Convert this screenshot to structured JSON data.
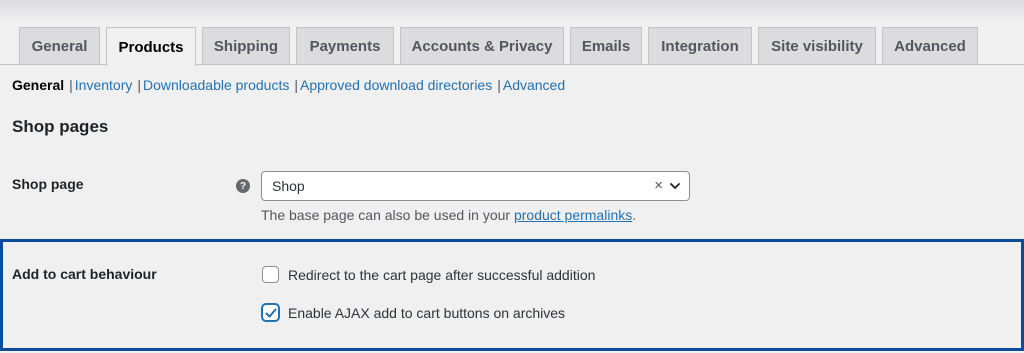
{
  "tabs": [
    {
      "label": "General",
      "active": false
    },
    {
      "label": "Products",
      "active": true
    },
    {
      "label": "Shipping",
      "active": false
    },
    {
      "label": "Payments",
      "active": false
    },
    {
      "label": "Accounts & Privacy",
      "active": false
    },
    {
      "label": "Emails",
      "active": false
    },
    {
      "label": "Integration",
      "active": false
    },
    {
      "label": "Site visibility",
      "active": false
    },
    {
      "label": "Advanced",
      "active": false
    }
  ],
  "subnav": {
    "current": "General",
    "separator": "|",
    "links": [
      "Inventory",
      "Downloadable products",
      "Approved download directories",
      "Advanced"
    ]
  },
  "section": {
    "title": "Shop pages"
  },
  "shop_page": {
    "label": "Shop page",
    "help_icon": "?",
    "value": "Shop",
    "clear_symbol": "×",
    "desc_prefix": "The base page can also be used in your ",
    "desc_link": "product permalinks",
    "desc_suffix": "."
  },
  "cart_behaviour": {
    "label": "Add to cart behaviour",
    "options": [
      {
        "label": "Redirect to the cart page after successful addition",
        "checked": false
      },
      {
        "label": "Enable AJAX add to cart buttons on archives",
        "checked": true
      }
    ]
  },
  "colors": {
    "link": "#2271b1",
    "highlight_border": "#0a4b9c",
    "tab_bg": "#dcdcde",
    "page_bg": "#f0f0f1"
  }
}
